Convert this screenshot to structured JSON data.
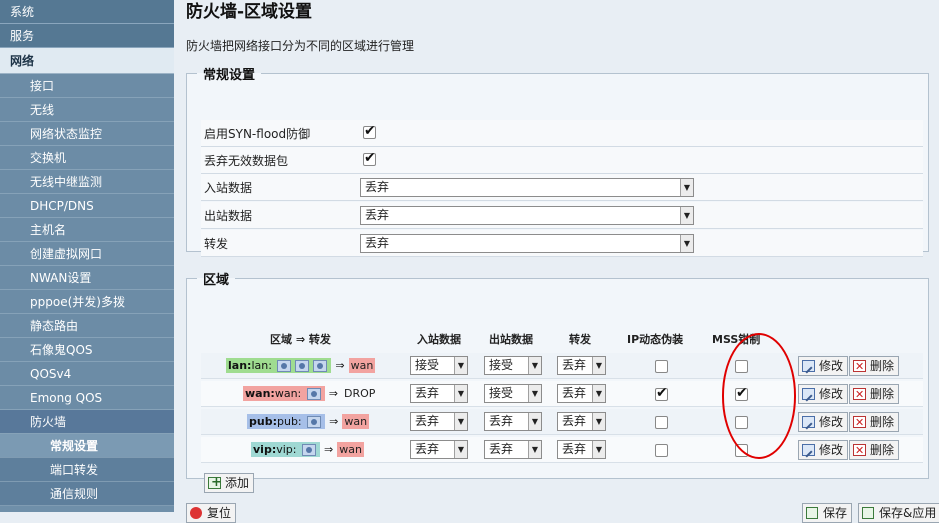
{
  "sidebar": {
    "system": "系统",
    "services": "服务",
    "network": "网络",
    "items": [
      "接口",
      "无线",
      "网络状态监控",
      "交换机",
      "无线中继监测",
      "DHCP/DNS",
      "主机名",
      "创建虚拟网口",
      "NWAN设置",
      "pppoe(并发)多拨",
      "静态路由",
      "石像鬼QOS",
      "QOSv4",
      "Emong QOS",
      "防火墙"
    ],
    "subitems": [
      "常规设置",
      "端口转发",
      "通信规则"
    ]
  },
  "page": {
    "title": "防火墙-区域设置",
    "description": "防火墙把网络接口分为不同的区域进行管理"
  },
  "general": {
    "legend": "常规设置",
    "syn_label": "启用SYN-flood防御",
    "syn_checked": true,
    "drop_invalid_label": "丢弃无效数据包",
    "drop_invalid_checked": true,
    "input_label": "入站数据",
    "input_value": "丢弃",
    "output_label": "出站数据",
    "output_value": "丢弃",
    "forward_label": "转发",
    "forward_value": "丢弃"
  },
  "zones": {
    "legend": "区域",
    "headers": {
      "zone": "区域 ⇒ 转发",
      "input": "入站数据",
      "output": "出站数据",
      "forward": "转发",
      "masq": "IP动态伪装",
      "mss": "MSS钳制"
    },
    "rows": [
      {
        "zone": "lan:",
        "iface": "lan:",
        "dest": "wan",
        "input": "接受",
        "output": "接受",
        "forward": "丢弃",
        "masq": false,
        "mss": false
      },
      {
        "zone": "wan:",
        "iface": "wan:",
        "dest": "DROP",
        "input": "丢弃",
        "output": "接受",
        "forward": "丢弃",
        "masq": true,
        "mss": true
      },
      {
        "zone": "pub:",
        "iface": "pub:",
        "dest": "wan",
        "input": "丢弃",
        "output": "丢弃",
        "forward": "丢弃",
        "masq": false,
        "mss": false
      },
      {
        "zone": "vip:",
        "iface": "vip:",
        "dest": "wan",
        "input": "丢弃",
        "output": "丢弃",
        "forward": "丢弃",
        "masq": false,
        "mss": false
      }
    ],
    "arrow": "⇒",
    "edit_label": "修改",
    "delete_label": "删除",
    "add_label": "添加"
  },
  "footer": {
    "reset_label": "复位",
    "save_label": "保存",
    "save_apply_label": "保存&应用"
  },
  "colors": {
    "lan": "#9fdc90",
    "wan": "#f2a3a0",
    "pub": "#a6bfe8",
    "vip": "#9fd8d3",
    "annotation": "#e00000"
  }
}
